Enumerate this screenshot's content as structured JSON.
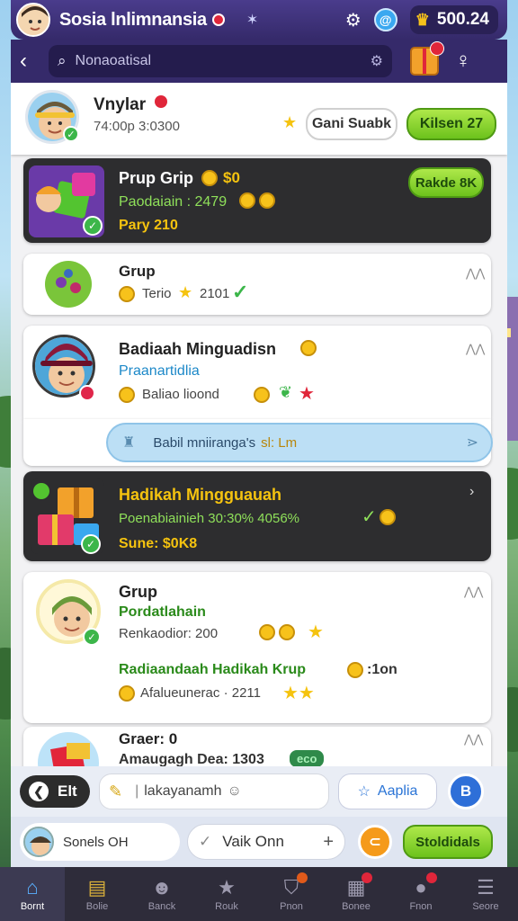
{
  "header": {
    "app_title": "Sosia lnlimnansia",
    "coins": "500.24"
  },
  "search": {
    "value": "Nonaoatisal"
  },
  "profile": {
    "name": "Vnylar",
    "meta": "74:00p 3:0300",
    "secondary_button": "Gani Suabk",
    "primary_button": "Kilsen 27"
  },
  "items": [
    {
      "title": "Prup Grip",
      "amount": "$0",
      "line2": "Paodaiain : 2479",
      "line3": "Pary 210",
      "action": "Rakde 8K"
    },
    {
      "title": "Grup",
      "line2": "Terio",
      "line2b": "2101"
    },
    {
      "title": "Badiaah Minguadisn",
      "subtitle": "Praanartidlia",
      "line3": "Baliao lioond"
    },
    {
      "banner": "Babil mniiranga's",
      "banner_accent": "sl: Lm"
    },
    {
      "title": "Hadikah Mingguauah",
      "line2": "Poenabiainieh 30:30% 4056%",
      "line3": "Sune: $0K8"
    },
    {
      "title": "Grup",
      "subtitle": "Pordatlahain",
      "line3": "Renkaodior: 200",
      "line4": "Radiaandaah Hadikah Krup",
      "line4b": ":1on",
      "line5": "Afalueunerac · 2211"
    },
    {
      "title": "Graer: 0",
      "line2": "Amaugagh Dea: 1303",
      "tag": "eco"
    }
  ],
  "composer": {
    "toggle_label": "Elt",
    "input_value": "lakayanamh",
    "apply_label": "Aaplia",
    "round_label": "B"
  },
  "actionbar": {
    "user_label": "Sonels OH",
    "field_value": "Vaik Onn",
    "submit_label": "Stoldidals"
  },
  "nav": [
    {
      "label": "Bornt",
      "icon": "home-icon",
      "active": true
    },
    {
      "label": "Bolie",
      "icon": "cards-icon"
    },
    {
      "label": "Banck",
      "icon": "face-icon"
    },
    {
      "label": "Rouk",
      "icon": "star-icon"
    },
    {
      "label": "Pnon",
      "icon": "shop-icon",
      "badge": true
    },
    {
      "label": "Bonee",
      "icon": "map-icon",
      "badge": true
    },
    {
      "label": "Fnon",
      "icon": "chat-icon",
      "badge": true
    },
    {
      "label": "Seore",
      "icon": "menu-icon"
    }
  ],
  "colors": {
    "header_bg": "#4a3c8c",
    "accent_green": "#6cc21c",
    "dark_card": "#2d2d2f",
    "link_blue": "#2a74d6"
  }
}
